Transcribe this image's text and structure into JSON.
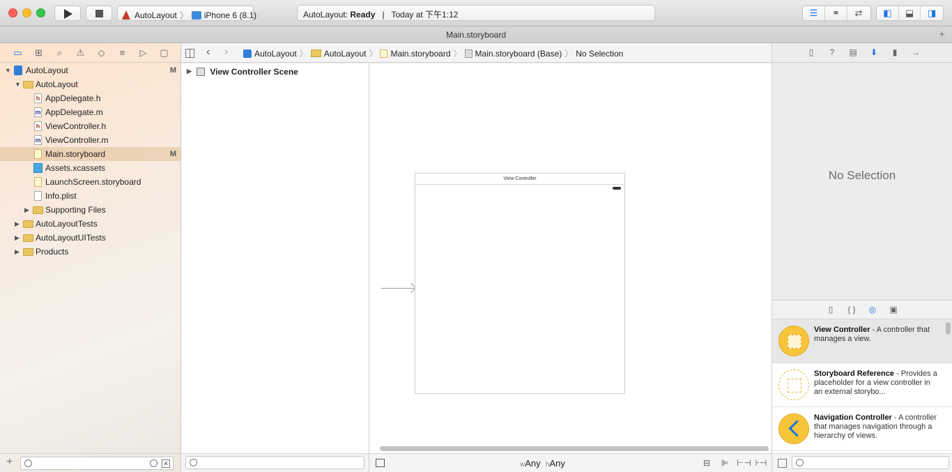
{
  "toolbar": {
    "run_icon": "play-icon",
    "stop_icon": "stop-icon",
    "scheme": "AutoLayout",
    "device": "iPhone 6 (8.1)",
    "activity_prefix": "AutoLayout: ",
    "activity_status": "Ready",
    "activity_sep": "|",
    "activity_time": "Today at 下午1:12"
  },
  "tab": {
    "title": "Main.storyboard"
  },
  "jumpbar": {
    "items": [
      "AutoLayout",
      "AutoLayout",
      "Main.storyboard",
      "Main.storyboard (Base)",
      "No Selection"
    ]
  },
  "navigator": {
    "items": [
      {
        "label": "AutoLayout",
        "badge": "M"
      },
      {
        "label": "AutoLayout"
      },
      {
        "label": "AppDelegate.h",
        "type_letter": "h"
      },
      {
        "label": "AppDelegate.m",
        "type_letter": "m"
      },
      {
        "label": "ViewController.h",
        "type_letter": "h"
      },
      {
        "label": "ViewController.m",
        "type_letter": "m"
      },
      {
        "label": "Main.storyboard",
        "badge": "M"
      },
      {
        "label": "Assets.xcassets"
      },
      {
        "label": "LaunchScreen.storyboard"
      },
      {
        "label": "Info.plist"
      },
      {
        "label": "Supporting Files"
      },
      {
        "label": "AutoLayoutTests"
      },
      {
        "label": "AutoLayoutUITests"
      },
      {
        "label": "Products"
      }
    ]
  },
  "outline": {
    "scene": "View Controller Scene"
  },
  "canvas": {
    "vc_title": "View Controller",
    "size_w_prefix": "w",
    "size_w": "Any",
    "size_h_prefix": "h",
    "size_h": "Any"
  },
  "inspector": {
    "empty": "No Selection"
  },
  "library": {
    "items": [
      {
        "title": "View Controller",
        "desc": " - A controller that manages a view."
      },
      {
        "title": "Storyboard Reference",
        "desc": " - Provides a placeholder for a view controller in an external storybo..."
      },
      {
        "title": "Navigation Controller",
        "desc": " - A controller that manages navigation through a hierarchy of views."
      }
    ]
  },
  "colors": {
    "accent": "#1b74e4",
    "selection": "#e6c7a3",
    "folder": "#e9c660"
  }
}
